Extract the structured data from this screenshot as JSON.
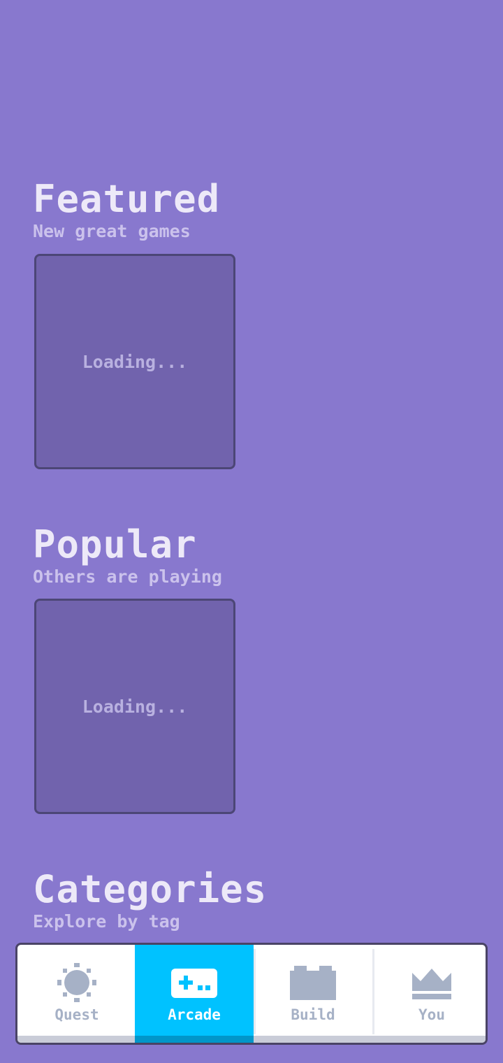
{
  "sections": {
    "featured": {
      "title": "Featured",
      "subtitle": "New great games",
      "card_status": "Loading..."
    },
    "popular": {
      "title": "Popular",
      "subtitle": "Others are playing",
      "card_status": "Loading..."
    },
    "categories": {
      "title": "Categories",
      "subtitle": "Explore by tag"
    }
  },
  "nav": {
    "active": "Arcade",
    "tabs": [
      {
        "label": "Quest",
        "icon": "gear-icon"
      },
      {
        "label": "Arcade",
        "icon": "gamepad-icon"
      },
      {
        "label": "Build",
        "icon": "brick-icon"
      },
      {
        "label": "You",
        "icon": "crown-icon"
      }
    ]
  },
  "colors": {
    "background": "#8878CE",
    "card": "#7163AD",
    "active_tab": "#00C2FF",
    "inactive_icon": "#A6B1C6"
  }
}
